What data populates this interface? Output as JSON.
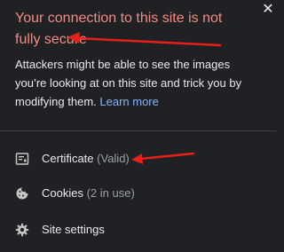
{
  "popup": {
    "close_glyph": "✕",
    "title": "Your connection to this site is not fully secure",
    "description": "Attackers might be able to see the images you’re looking at on this site and trick you by modifying them.",
    "learn_more": "Learn more"
  },
  "menu": {
    "certificate": {
      "label": "Certificate",
      "status": "(Valid)",
      "icon": "certificate-icon"
    },
    "cookies": {
      "label": "Cookies",
      "status": "(2 in use)",
      "icon": "cookie-icon"
    },
    "site_settings": {
      "label": "Site settings",
      "icon": "gear-icon"
    }
  },
  "colors": {
    "background": "#202124",
    "title_red": "#f28b82",
    "link_blue": "#8ab4f8",
    "arrow_red": "#e8201a",
    "muted": "#9aa0a6"
  }
}
